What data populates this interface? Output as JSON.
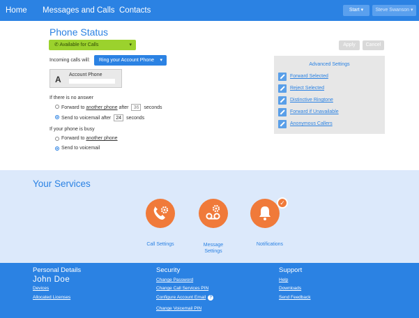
{
  "nav": {
    "home": "Home",
    "messages_calls": "Messages and Calls",
    "contacts": "Contacts",
    "start_label": "Start ▾",
    "user_label": "Steve Swanson ▾"
  },
  "phone_status": {
    "title": "Phone Status",
    "availability": "Available for Calls",
    "incoming_label": "Incoming calls will:",
    "ring_option": "Ring your Account Phone",
    "account_letter": "A",
    "account_name": "Account Phone",
    "apply_label": "Apply",
    "cancel_label": "Cancel",
    "no_answer": {
      "heading": "If there is no answer",
      "forward_prefix": "Forward to ",
      "forward_link": "another phone",
      "forward_after": " after ",
      "forward_seconds": "36",
      "forward_suffix": " seconds",
      "vm_prefix": "Send to voicemail after ",
      "vm_seconds": "24",
      "vm_suffix": " seconds",
      "selected": "voicemail"
    },
    "busy": {
      "heading": "If your phone is busy",
      "forward_prefix": "Forward to ",
      "forward_link": "another phone",
      "vm_label": "Send to voicemail",
      "selected": "voicemail"
    }
  },
  "advanced": {
    "title": "Advanced Settings",
    "items": [
      {
        "label": "Forward Selected"
      },
      {
        "label": "Reject Selected"
      },
      {
        "label": "Distinctive Ringtone"
      },
      {
        "label": "Forward if Unavailable"
      },
      {
        "label": "Anonymous Callers"
      }
    ]
  },
  "services": {
    "title": "Your Services",
    "items": [
      {
        "label": "Call Settings",
        "icon": "phone-gear-icon"
      },
      {
        "label": "Message Settings",
        "icon": "voicemail-gear-icon"
      },
      {
        "label": "Notifications",
        "icon": "bell-icon"
      }
    ]
  },
  "footer": {
    "personal": {
      "heading": "Personal Details",
      "name": "John Doe",
      "links": [
        "Devices",
        "Allocated Licenses"
      ]
    },
    "security": {
      "heading": "Security",
      "links": [
        "Change Password",
        "Change Call Services PIN",
        "Configure Account Email",
        "Change Voicemail PIN"
      ]
    },
    "support": {
      "heading": "Support",
      "links": [
        "Help",
        "Downloads",
        "Send Feedback"
      ]
    }
  },
  "colors": {
    "primary": "#2b82e3",
    "available": "#9bd22d",
    "service_orange": "#f07a3a",
    "services_bg": "#dce9fb"
  }
}
